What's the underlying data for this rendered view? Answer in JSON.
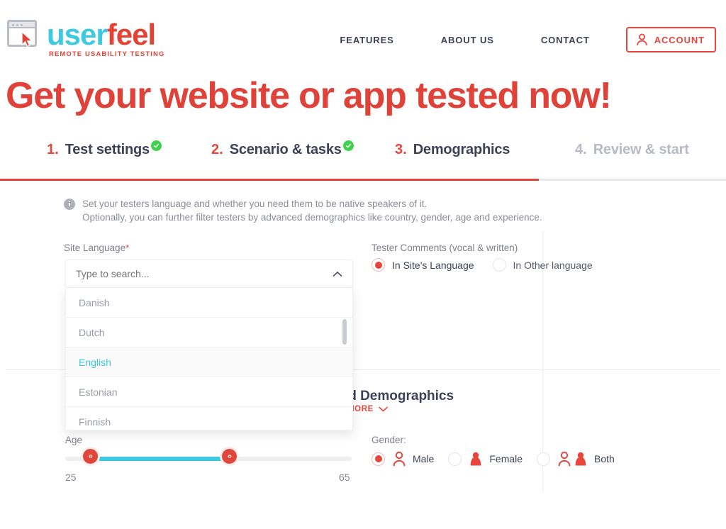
{
  "brand": {
    "name_part1": "user",
    "name_part2": "feel",
    "tagline": "REMOTE USABILITY TESTING",
    "logo_icon": "browser-window-cursor-icon",
    "color_teal": "#3dc9e0",
    "color_red": "#e34234"
  },
  "nav": {
    "links": [
      {
        "label": "FEATURES"
      },
      {
        "label": "ABOUT US"
      },
      {
        "label": "CONTACT"
      }
    ],
    "account": {
      "label": "ACCOUNT",
      "icon": "person-icon",
      "color": "#e8453c"
    }
  },
  "hero": {
    "title": "Get your website or app tested now!",
    "color": "#de4238"
  },
  "steps": [
    {
      "num": "1.",
      "label": "Test settings",
      "state": "done",
      "check": true
    },
    {
      "num": "2.",
      "label": "Scenario & tasks",
      "state": "done",
      "check": true
    },
    {
      "num": "3.",
      "label": "Demographics",
      "state": "active",
      "check": false
    },
    {
      "num": "4.",
      "label": "Review & start",
      "state": "muted",
      "check": false
    }
  ],
  "info": {
    "icon": "info-icon",
    "line1": "Set your testers language and whether you need them to be native speakers of it.",
    "line2": "Optionally, you can further filter testers by advanced demographics like country, gender, age and experience."
  },
  "site_language": {
    "label": "Site Language",
    "required_marker": "*",
    "placeholder": "Type to search...",
    "value": "",
    "chevron": "chevron-up-icon",
    "options": [
      {
        "label": "Danish",
        "selected": false
      },
      {
        "label": "Dutch",
        "selected": false
      },
      {
        "label": "English",
        "selected": true
      },
      {
        "label": "Estonian",
        "selected": false
      },
      {
        "label": "Finnish",
        "selected": false
      }
    ],
    "selected_color": "#3dc9e0"
  },
  "tester_comments": {
    "label": "Tester Comments (vocal & written)",
    "options": [
      {
        "label": "In Site's Language",
        "selected": true
      },
      {
        "label": "In Other language",
        "selected": false
      }
    ]
  },
  "advanced_demographics": {
    "title": "Advanced Demographics",
    "show_more": "SHOW MORE",
    "chevron": "chevron-down-icon"
  },
  "age": {
    "label": "Age",
    "min": "25",
    "max": "65",
    "range_min": 18,
    "range_max": 99,
    "handle_glyph": "‹›",
    "fill_color": "#3dc9e0",
    "handle_color": "#e0473c"
  },
  "gender": {
    "label": "Gender:",
    "options": [
      {
        "label": "Male",
        "selected": true,
        "icons": [
          "person-male-icon"
        ]
      },
      {
        "label": "Female",
        "selected": false,
        "icons": [
          "person-female-icon"
        ]
      },
      {
        "label": "Both",
        "selected": false,
        "icons": [
          "person-male-icon",
          "person-female-icon"
        ]
      }
    ]
  }
}
